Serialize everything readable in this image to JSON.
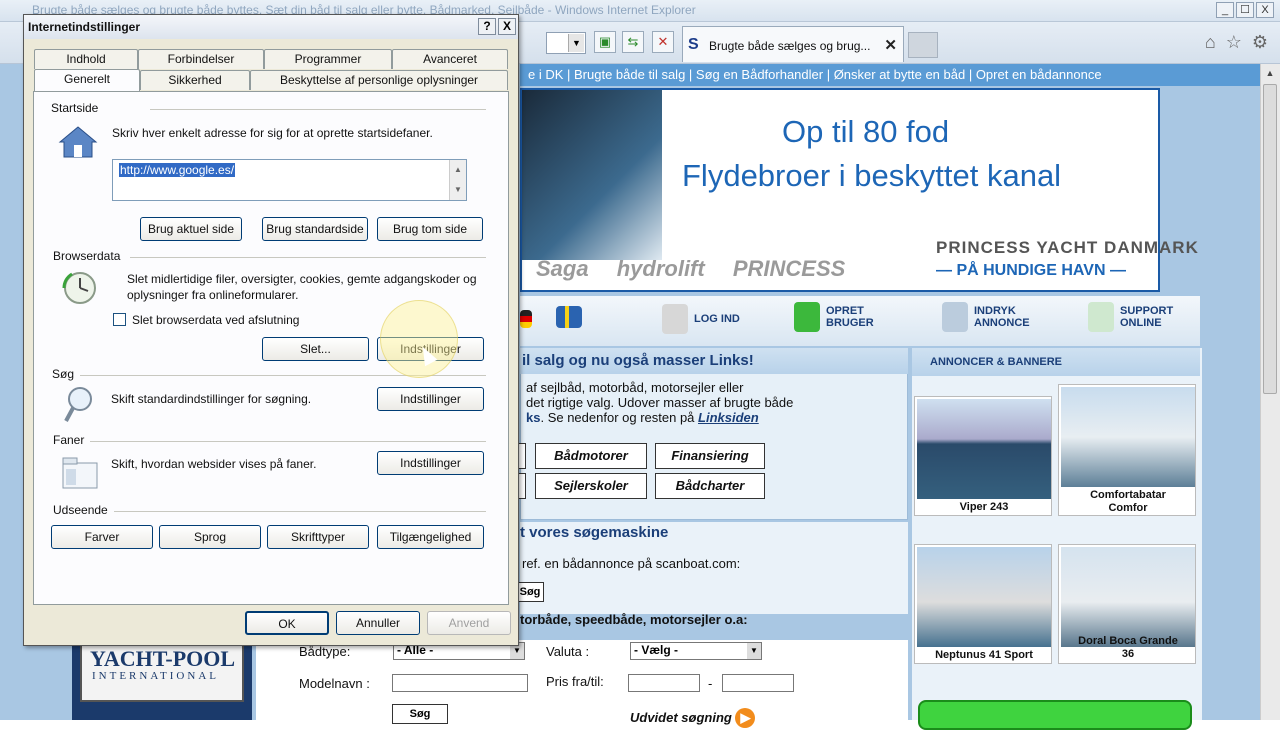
{
  "browser": {
    "title": "Brugte både sælges og brugte både byttes. Sæt din båd til salg eller bytte. Bådmarked, Sejlbåde - Windows Internet Explorer",
    "tab_title": "Brugte både sælges og brug...",
    "tab_logo": "S",
    "win_min": "_",
    "win_max": "☐",
    "win_close": "X"
  },
  "page": {
    "linkbar": "e i DK | Brugte både til salg | Søg en Bådforhandler | Ønsker at bytte en båd | Opret en bådannonce",
    "banner": {
      "line1": "Op til 80 fod",
      "line2": "Flydebroer i beskyttet kanal",
      "logo_saga": "Saga",
      "logo_hydrolift": "hydrolift",
      "logo_princess": "PRINCESS",
      "brand1": "PRINCESS YACHT DANMARK",
      "brand2": "— PÅ HUNDIGE HAVN —"
    },
    "menu": {
      "login": "LOG IND",
      "create_user": "OPRET\nBRUGER",
      "insert_ad": "INDRYK\nANNONCE",
      "support": "SUPPORT\nONLINE"
    },
    "content": {
      "heading": "il salg og nu også masser Links!",
      "text1": "af sejlbåd, motorbåd, motorsejler eller",
      "text2": "det rigtige valg. Udover masser af brugte både",
      "text3a": "ks",
      "text3b": ". Se nedenfor og resten på ",
      "text3c": "Linksiden",
      "btn_baadmotorer": "Bådmotorer",
      "btn_finansiering": "Finansiering",
      "btn_sejlerskoler": "Sejlerskoler",
      "btn_baadcharter": "Bådcharter"
    },
    "search": {
      "heading": "t vores søgemaskine",
      "text": "ref. en bådannonce på scanboat.com:",
      "go_btn": "Søg",
      "subheading": "torbåde, speedbåde, motorsejler o.a:",
      "boattype_label": "Bådtype:",
      "boattype_value": "- Alle -",
      "currency_label": "Valuta :",
      "currency_value": "- Vælg -",
      "model_label": "Modelnavn :",
      "price_label": "Pris fra/til:",
      "price_sep": "-",
      "search_btn": "Søg",
      "advanced": "Udvidet søgning"
    },
    "yacht_logo": {
      "line1": "YACHT-POOL",
      "line2": "INTERNATIONAL"
    },
    "ads": {
      "heading": "ANNONCER & BANNERE",
      "items": [
        {
          "caption": "Viper 243"
        },
        {
          "caption": "Comfortabatar\nComfor"
        },
        {
          "caption": "Neptunus 41 Sport"
        },
        {
          "caption": "Doral Boca Grande\n36"
        }
      ]
    }
  },
  "dialog": {
    "title": "Internetindstillinger",
    "help": "?",
    "close": "X",
    "tabs_row1": [
      "Indhold",
      "Forbindelser",
      "Programmer",
      "Avanceret"
    ],
    "tabs_row2": [
      "Generelt",
      "Sikkerhed",
      "Beskyttelse af personlige oplysninger"
    ],
    "home": {
      "label": "Startside",
      "desc": "Skriv hver enkelt adresse for sig for at oprette startsidefaner.",
      "url": "http://www.google.es/",
      "btn_current": "Brug aktuel side",
      "btn_default": "Brug standardside",
      "btn_blank": "Brug tom side"
    },
    "history": {
      "label": "Browserdata",
      "desc": "Slet midlertidige filer, oversigter, cookies, gemte adgangskoder og oplysninger fra onlineformularer.",
      "checkbox": "Slet browserdata ved afslutning",
      "btn_delete": "Slet...",
      "btn_settings": "Indstillinger"
    },
    "search": {
      "label": "Søg",
      "desc": "Skift standardindstillinger for søgning.",
      "btn_settings": "Indstillinger"
    },
    "tabs": {
      "label": "Faner",
      "desc": "Skift, hvordan websider vises på faner.",
      "btn_settings": "Indstillinger"
    },
    "appearance": {
      "label": "Udseende",
      "btn_colors": "Farver",
      "btn_languages": "Sprog",
      "btn_fonts": "Skrifttyper",
      "btn_accessibility": "Tilgængelighed"
    },
    "footer": {
      "ok": "OK",
      "cancel": "Annuller",
      "apply": "Anvend"
    }
  }
}
